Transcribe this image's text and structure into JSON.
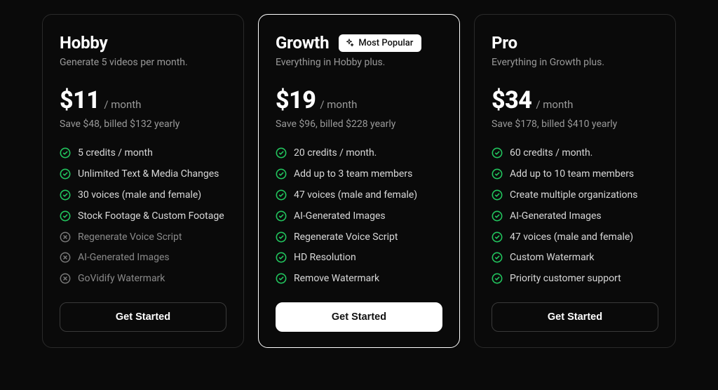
{
  "colors": {
    "accent_ok": "#22c55e",
    "muted": "#7a7a7a"
  },
  "badge": {
    "label": "Most Popular"
  },
  "cta": {
    "label": "Get Started"
  },
  "plans": [
    {
      "name": "Hobby",
      "subtitle": "Generate 5 videos per month.",
      "price": "$11",
      "period": "/ month",
      "savings": "Save $48, billed $132 yearly",
      "featured": false,
      "cta_primary": false,
      "features": [
        {
          "label": "5 credits / month",
          "included": true
        },
        {
          "label": "Unlimited Text & Media Changes",
          "included": true
        },
        {
          "label": "30 voices (male and female)",
          "included": true
        },
        {
          "label": "Stock Footage & Custom Footage",
          "included": true
        },
        {
          "label": "Regenerate Voice Script",
          "included": false
        },
        {
          "label": "AI-Generated Images",
          "included": false
        },
        {
          "label": "GoVidify Watermark",
          "included": false
        }
      ]
    },
    {
      "name": "Growth",
      "subtitle": "Everything in Hobby plus.",
      "price": "$19",
      "period": "/ month",
      "savings": "Save $96, billed $228 yearly",
      "featured": true,
      "cta_primary": true,
      "features": [
        {
          "label": "20 credits / month.",
          "included": true
        },
        {
          "label": "Add up to 3 team members",
          "included": true
        },
        {
          "label": "47 voices (male and female)",
          "included": true
        },
        {
          "label": "AI-Generated Images",
          "included": true
        },
        {
          "label": "Regenerate Voice Script",
          "included": true
        },
        {
          "label": "HD Resolution",
          "included": true
        },
        {
          "label": "Remove Watermark",
          "included": true
        }
      ]
    },
    {
      "name": "Pro",
      "subtitle": "Everything in Growth plus.",
      "price": "$34",
      "period": "/ month",
      "savings": "Save $178, billed $410 yearly",
      "featured": false,
      "cta_primary": false,
      "features": [
        {
          "label": "60 credits / month.",
          "included": true
        },
        {
          "label": "Add up to 10 team members",
          "included": true
        },
        {
          "label": "Create multiple organizations",
          "included": true
        },
        {
          "label": "AI-Generated Images",
          "included": true
        },
        {
          "label": "47 voices (male and female)",
          "included": true
        },
        {
          "label": "Custom Watermark",
          "included": true
        },
        {
          "label": "Priority customer support",
          "included": true
        }
      ]
    }
  ]
}
